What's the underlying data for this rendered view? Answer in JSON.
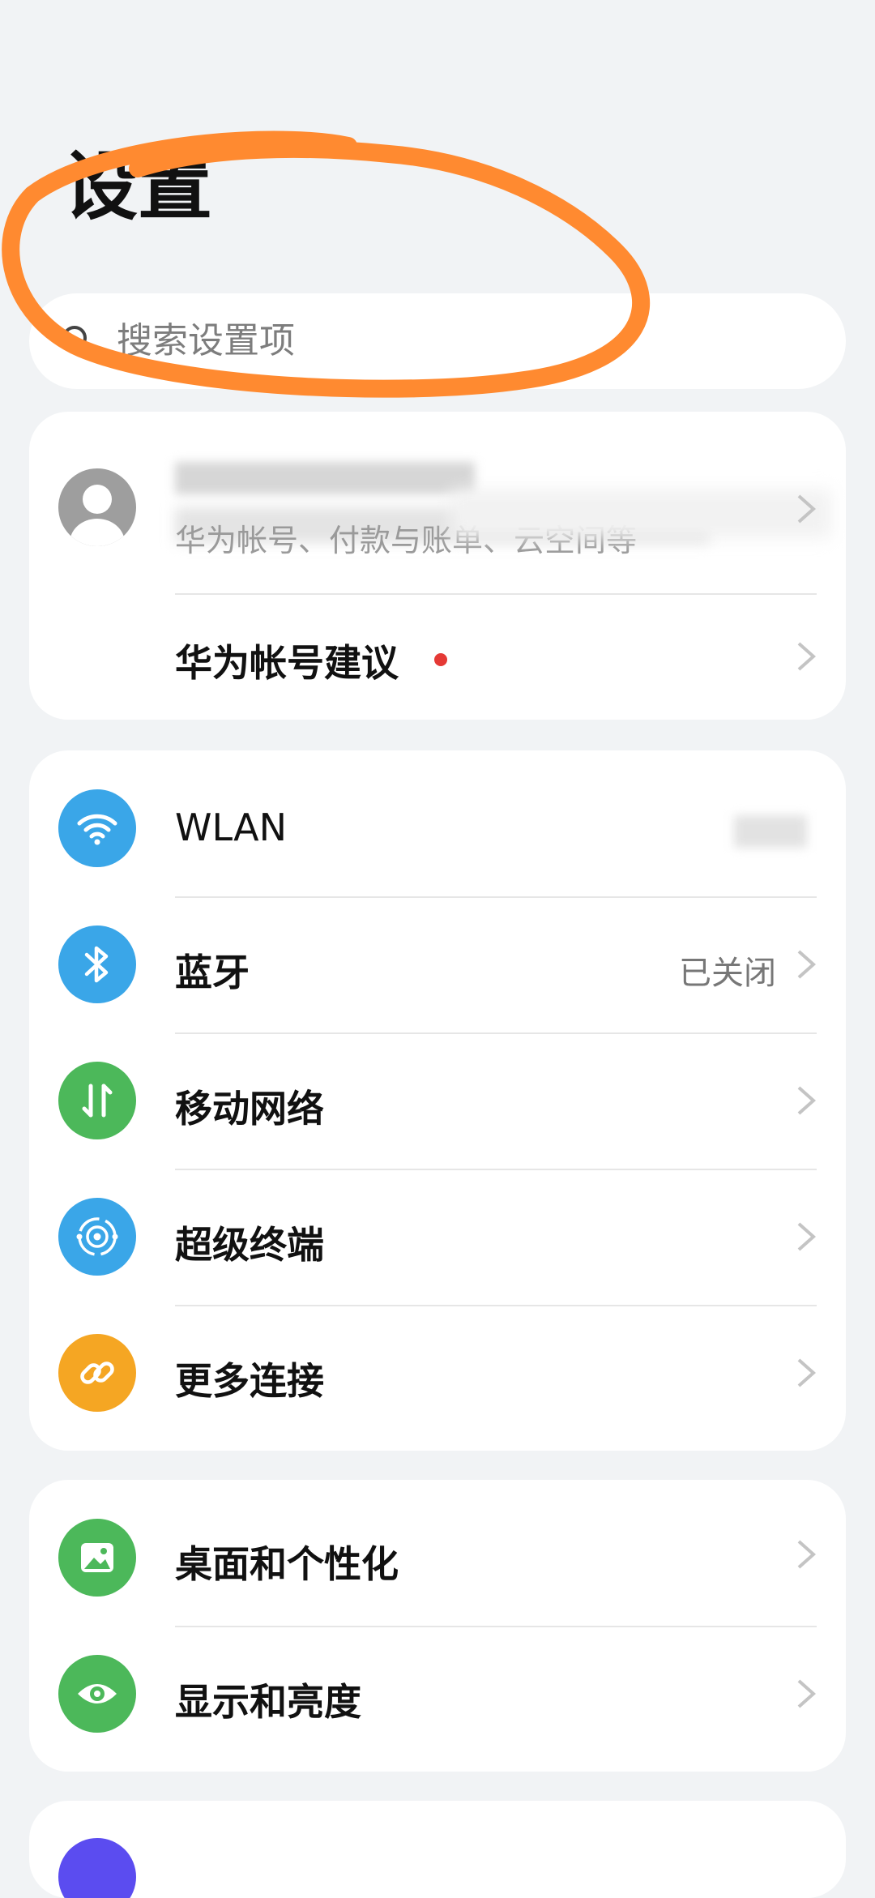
{
  "header": {
    "title": "设置"
  },
  "search": {
    "placeholder": "搜索设置项"
  },
  "account": {
    "subtitle": "华为帐号、付款与账单、云空间等",
    "suggestion_label": "华为帐号建议"
  },
  "connectivity": [
    {
      "label": "WLAN",
      "status": ""
    },
    {
      "label": "蓝牙",
      "status": "已关闭"
    },
    {
      "label": "移动网络",
      "status": ""
    },
    {
      "label": "超级终端",
      "status": ""
    },
    {
      "label": "更多连接",
      "status": ""
    }
  ],
  "display": [
    {
      "label": "桌面和个性化"
    },
    {
      "label": "显示和亮度"
    }
  ],
  "colors": {
    "background": "#f1f3f5",
    "blue": "#3aa6e8",
    "green": "#4cb85a",
    "orange": "#f5a623",
    "annotation": "#ff8a30"
  }
}
